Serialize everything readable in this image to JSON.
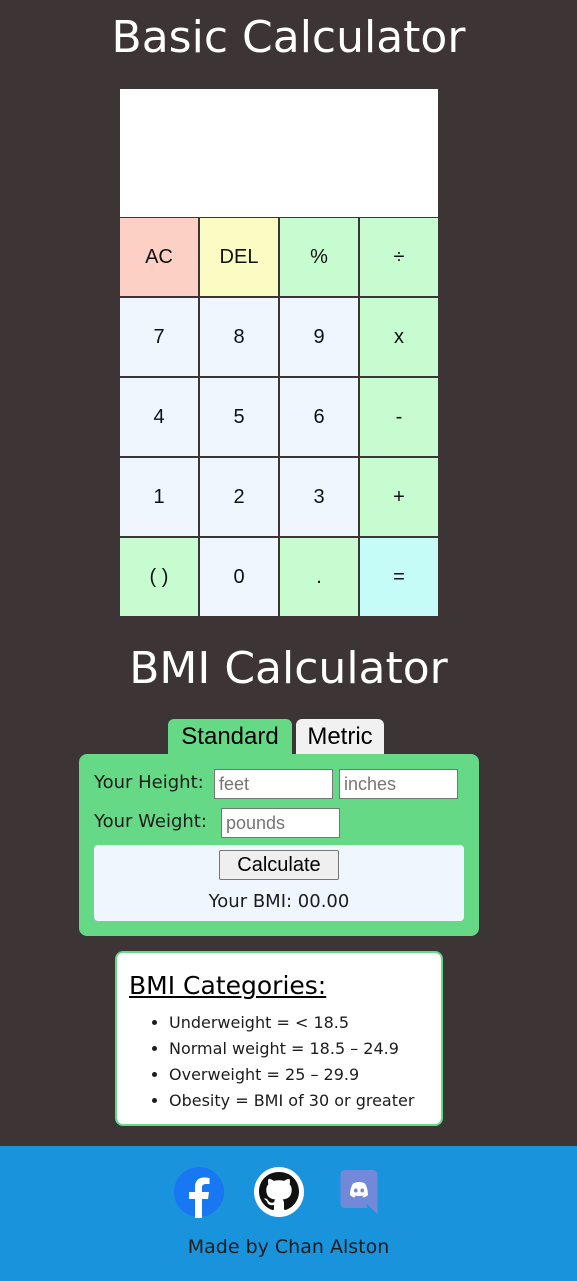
{
  "calculator": {
    "title": "Basic Calculator",
    "display": "",
    "keys": [
      {
        "label": "AC",
        "color": "#fdd0c5"
      },
      {
        "label": "DEL",
        "color": "#fafcc4"
      },
      {
        "label": "%",
        "color": "#c7fbd0"
      },
      {
        "label": "÷",
        "color": "#c7fbd0"
      },
      {
        "label": "7",
        "color": "#f0f6fe"
      },
      {
        "label": "8",
        "color": "#f0f6fe"
      },
      {
        "label": "9",
        "color": "#f0f6fe"
      },
      {
        "label": "x",
        "color": "#c7fbd0"
      },
      {
        "label": "4",
        "color": "#f0f6fe"
      },
      {
        "label": "5",
        "color": "#f0f6fe"
      },
      {
        "label": "6",
        "color": "#f0f6fe"
      },
      {
        "label": "-",
        "color": "#c7fbd0"
      },
      {
        "label": "1",
        "color": "#f0f6fe"
      },
      {
        "label": "2",
        "color": "#f0f6fe"
      },
      {
        "label": "3",
        "color": "#f0f6fe"
      },
      {
        "label": "+",
        "color": "#c7fbd0"
      },
      {
        "label": "( )",
        "color": "#c7fbd0"
      },
      {
        "label": "0",
        "color": "#f0f6fe"
      },
      {
        "label": ".",
        "color": "#c7fbd0"
      },
      {
        "label": "=",
        "color": "#c6fcf8"
      }
    ]
  },
  "bmi": {
    "title": "BMI Calculator",
    "tabs": {
      "standard": "Standard",
      "metric": "Metric"
    },
    "height_label": "Your Height:",
    "weight_label": "Your Weight:",
    "feet_placeholder": "feet",
    "inches_placeholder": "inches",
    "pounds_placeholder": "pounds",
    "calculate_label": "Calculate",
    "result": "Your BMI: 00.00"
  },
  "categories": {
    "title": "BMI Categories:",
    "items": [
      "Underweight = < 18.5",
      "Normal weight = 18.5 – 24.9",
      "Overweight = 25 – 29.9",
      "Obesity = BMI of 30 or greater"
    ]
  },
  "footer": {
    "icons": [
      "facebook-icon",
      "github-icon",
      "discord-icon"
    ],
    "credit": "Made by Chan Alston"
  },
  "colors": {
    "background": "#3c3435",
    "accent_green": "#66d987",
    "footer_blue": "#1a93dd"
  }
}
